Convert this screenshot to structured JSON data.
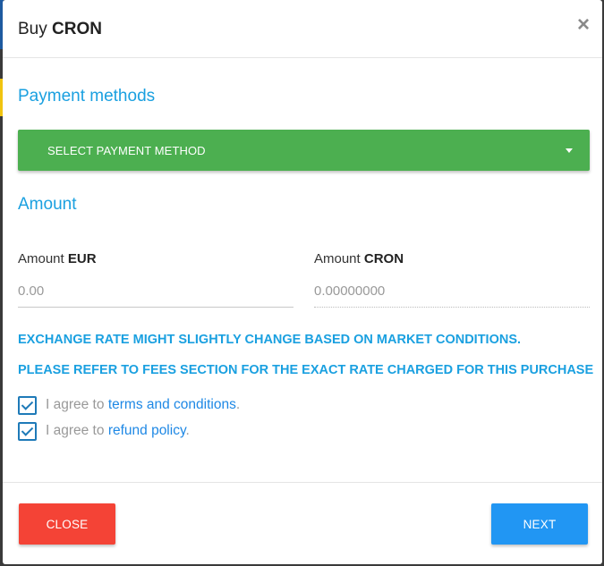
{
  "modal": {
    "title_prefix": "Buy",
    "title_coin": "CRON",
    "close_symbol": "×"
  },
  "payment": {
    "section_title": "Payment methods",
    "select_label": "SELECT PAYMENT METHOD"
  },
  "amount": {
    "section_title": "Amount",
    "fiat_label_prefix": "Amount",
    "fiat_currency": "EUR",
    "fiat_placeholder": "0.00",
    "coin_label_prefix": "Amount",
    "coin_currency": "CRON",
    "coin_placeholder": "0.00000000"
  },
  "notices": {
    "rate_change": "EXCHANGE RATE MIGHT SLIGHTLY CHANGE BASED ON MARKET CONDITIONS.",
    "fees_reference": "PLEASE REFER TO FEES SECTION FOR THE EXACT RATE CHARGED FOR THIS PURCHASE"
  },
  "agreements": {
    "terms": {
      "prefix": "I agree to",
      "link": "terms and conditions",
      "suffix": ".",
      "checked": true
    },
    "refund": {
      "prefix": "I agree to",
      "link": "refund policy",
      "suffix": ".",
      "checked": true
    }
  },
  "footer": {
    "close_label": "CLOSE",
    "next_label": "NEXT"
  },
  "colors": {
    "accent_blue": "#1aa0e0",
    "select_green": "#4caf50",
    "close_red": "#f44336",
    "next_blue": "#2196f3"
  }
}
